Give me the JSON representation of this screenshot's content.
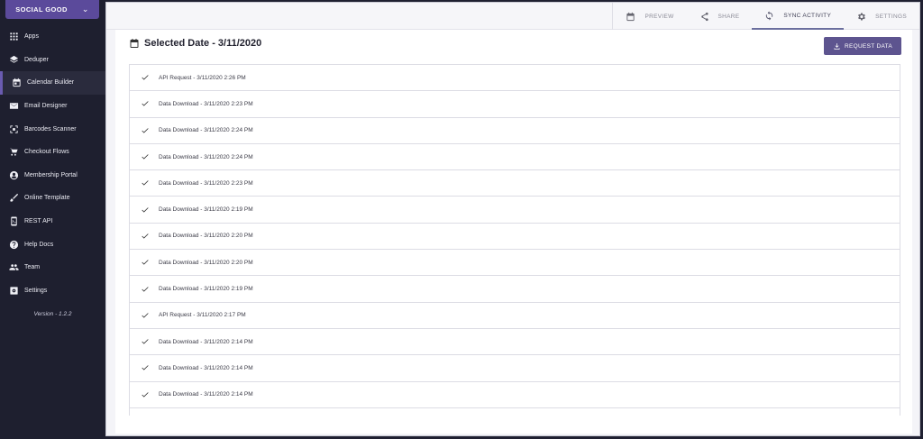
{
  "sidebar": {
    "org_label": "SOCIAL GOOD",
    "org_chevron": "chevron-down-icon",
    "items": [
      {
        "label": "Apps",
        "icon": "grid-icon"
      },
      {
        "label": "Deduper",
        "icon": "layers-icon"
      },
      {
        "label": "Calendar Builder",
        "icon": "calendar-icon"
      },
      {
        "label": "Email Designer",
        "icon": "mail-icon"
      },
      {
        "label": "Barcodes Scanner",
        "icon": "scan-icon"
      },
      {
        "label": "Checkout Flows",
        "icon": "cart-icon"
      },
      {
        "label": "Membership Portal",
        "icon": "account-icon"
      },
      {
        "label": "Online Template",
        "icon": "brush-icon"
      },
      {
        "label": "REST API",
        "icon": "phone-icon"
      },
      {
        "label": "Help Docs",
        "icon": "help-icon"
      },
      {
        "label": "Team",
        "icon": "people-icon"
      },
      {
        "label": "Settings",
        "icon": "settings-box-icon"
      }
    ],
    "active_item": "Calendar Builder",
    "version": "Version - 1.2.2"
  },
  "topbar": {
    "tabs": [
      {
        "label": "PREVIEW",
        "icon": "calendar-icon"
      },
      {
        "label": "SHARE",
        "icon": "share-icon"
      },
      {
        "label": "SYNC ACTIVITY",
        "icon": "sync-icon",
        "active": true
      },
      {
        "label": "SETTINGS",
        "icon": "gear-icon"
      }
    ]
  },
  "main": {
    "title": "Selected Date - 3/11/2020",
    "request_button": "REQUEST DATA",
    "rows": [
      "API Request - 3/11/2020 2:26 PM",
      "Data Download - 3/11/2020 2:23 PM",
      "Data Download - 3/11/2020 2:24 PM",
      "Data Download - 3/11/2020 2:24 PM",
      "Data Download - 3/11/2020 2:23 PM",
      "Data Download - 3/11/2020 2:19 PM",
      "Data Download - 3/11/2020 2:20 PM",
      "Data Download - 3/11/2020 2:20 PM",
      "Data Download - 3/11/2020 2:19 PM",
      "API Request - 3/11/2020 2:17 PM",
      "Data Download - 3/11/2020 2:14 PM",
      "Data Download - 3/11/2020 2:14 PM",
      "Data Download - 3/11/2020 2:14 PM"
    ]
  },
  "colors": {
    "sidebar_bg": "#1e1f2f",
    "accent": "#5d548f",
    "org_button": "#5b4a9b"
  }
}
